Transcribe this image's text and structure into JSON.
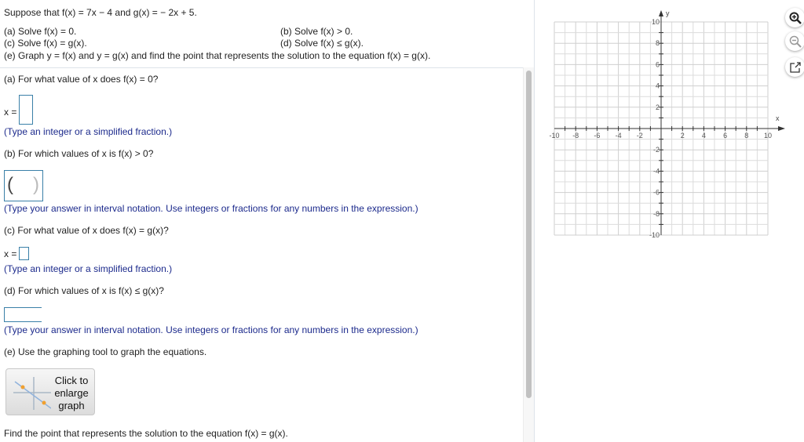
{
  "problem": {
    "intro": "Suppose that f(x) = 7x − 4 and g(x) = − 2x + 5.",
    "a": "(a) Solve f(x) = 0.",
    "b": "(b) Solve f(x) > 0.",
    "c": "(c) Solve f(x) = g(x).",
    "d": "(d) Solve f(x) ≤ g(x).",
    "e": "(e) Graph y = f(x) and y = g(x) and find the point that represents the solution to the equation f(x) = g(x)."
  },
  "parts": {
    "a_q": "(a) For what value of x does f(x) = 0?",
    "a_label": "x =",
    "a_hint": "(Type an integer or a simplified fraction.)",
    "b_q": "(b) For which values of x is f(x) > 0?",
    "b_hint": "(Type your answer in interval notation. Use integers or fractions for any numbers in the expression.)",
    "c_q": "(c) For what value of x does f(x) = g(x)?",
    "c_label": "x =",
    "c_hint": "(Type an integer or a simplified fraction.)",
    "d_q": "(d) For which values of x is f(x) ≤ g(x)?",
    "d_hint": "(Type your answer in interval notation. Use integers or fractions for any numbers in the expression.)",
    "e_q": "(e) Use the graphing tool to graph the equations.",
    "enlarge_button": "Click to enlarge graph",
    "final_q": "Find the point that represents the solution to the equation f(x) = g(x)."
  },
  "chart_data": {
    "type": "scatter",
    "xlim": [
      -10,
      10
    ],
    "ylim": [
      -10,
      10
    ],
    "grid": true,
    "xlabel": "x",
    "ylabel": "y",
    "x_ticks": [
      "-10",
      "-8",
      "-6",
      "-4",
      "-2",
      "2",
      "4",
      "6",
      "8",
      "10"
    ],
    "y_ticks": [
      "10",
      "8",
      "6",
      "4",
      "2",
      "-2",
      "-4",
      "-6",
      "-8",
      "-10"
    ],
    "series": []
  },
  "tools": [
    "zoom-in-icon",
    "zoom-out-icon",
    "pop-out-icon"
  ]
}
